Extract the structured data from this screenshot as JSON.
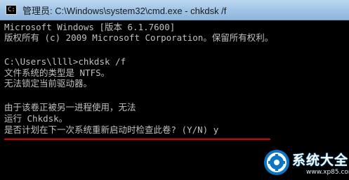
{
  "window": {
    "title": "管理员: C:\\Windows\\system32\\cmd.exe - chkdsk  /f",
    "icon_text": "C:\\"
  },
  "console": {
    "lines": [
      "Microsoft Windows [版本 6.1.7600]",
      "版权所有 (c) 2009 Microsoft Corporation。保留所有权利。",
      "",
      "C:\\Users\\llll>chkdsk /f",
      "文件系统的类型是 NTFS。",
      "无法锁定当前驱动器。",
      "",
      "由于该卷正被另一进程使用，无法",
      "运行 Chkdsk。",
      "是否计划在下一次系统重新启动时检查此卷? (Y/N) y"
    ]
  },
  "watermark": {
    "name": "系统大全",
    "url": "www.xp85.com"
  },
  "colors": {
    "console_bg": "#000000",
    "console_text": "#c0c0c0",
    "highlight_underline": "#d90000",
    "watermark_blue": "#0a76c6"
  }
}
